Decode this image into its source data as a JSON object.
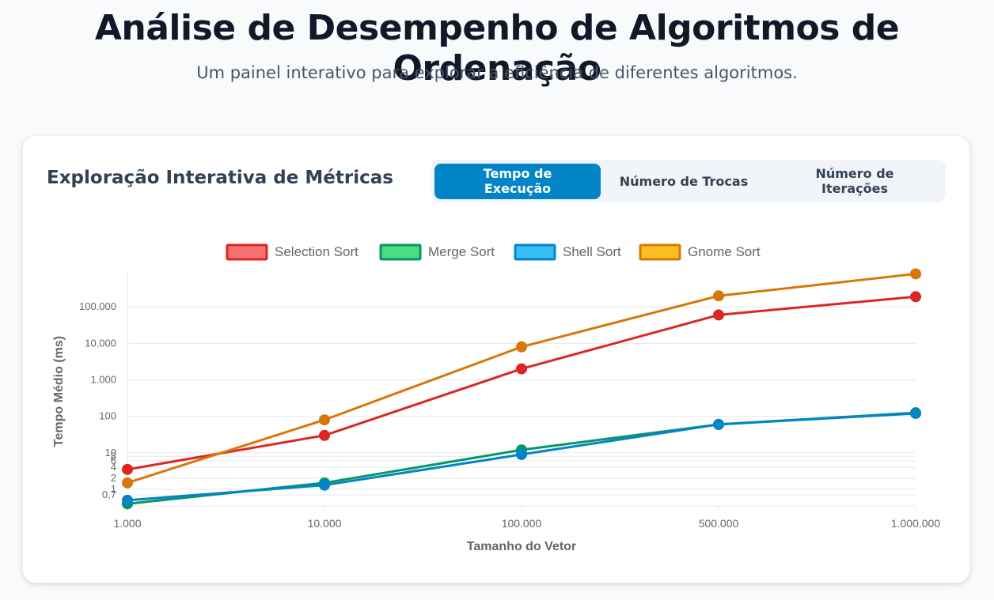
{
  "header": {
    "title": "Análise de Desempenho de Algoritmos de Ordenação",
    "subtitle": "Um painel interativo para explorar a eficiência de diferentes algoritmos."
  },
  "card": {
    "title": "Exploração Interativa de Métricas",
    "tabs": [
      {
        "label": "Tempo de Execução",
        "active": true
      },
      {
        "label": "Número de Trocas",
        "active": false
      },
      {
        "label": "Número de Iterações",
        "active": false
      }
    ]
  },
  "colors": {
    "accent": "#0284c7",
    "selection": "#dc2626",
    "merge": "#059669",
    "shell": "#0284c7",
    "gnome": "#d97706"
  },
  "chart_data": {
    "type": "line",
    "title": "",
    "xlabel": "Tamanho do Vetor",
    "ylabel": "Tempo Médio (ms)",
    "y_scale": "log",
    "ylim": [
      0.35,
      1000000
    ],
    "grid": true,
    "legend_position": "top",
    "categories": [
      "1.000",
      "10.000",
      "100.000",
      "500.000",
      "1.000.000"
    ],
    "y_ticks": [
      {
        "value": 0.7,
        "label": "0,7"
      },
      {
        "value": 1,
        "label": "1"
      },
      {
        "value": 2,
        "label": "2"
      },
      {
        "value": 4,
        "label": "4"
      },
      {
        "value": 6,
        "label": "6"
      },
      {
        "value": 8,
        "label": "8"
      },
      {
        "value": 10,
        "label": "10"
      },
      {
        "value": 100,
        "label": "100"
      },
      {
        "value": 1000,
        "label": "1.000"
      },
      {
        "value": 10000,
        "label": "10.000"
      },
      {
        "value": 100000,
        "label": "100.000"
      }
    ],
    "series": [
      {
        "name": "Selection Sort",
        "color": "#dc2626",
        "fill": "#f87171",
        "values": [
          3.5,
          30,
          2000,
          60000,
          190000
        ]
      },
      {
        "name": "Merge Sort",
        "color": "#059669",
        "fill": "#4ade80",
        "values": [
          0.4,
          1.5,
          12,
          60,
          125
        ]
      },
      {
        "name": "Shell Sort",
        "color": "#0284c7",
        "fill": "#38bdf8",
        "values": [
          0.5,
          1.3,
          9,
          60,
          120
        ]
      },
      {
        "name": "Gnome Sort",
        "color": "#d97706",
        "fill": "#fbbf24",
        "values": [
          1.5,
          80,
          8000,
          200000,
          800000
        ]
      }
    ]
  }
}
